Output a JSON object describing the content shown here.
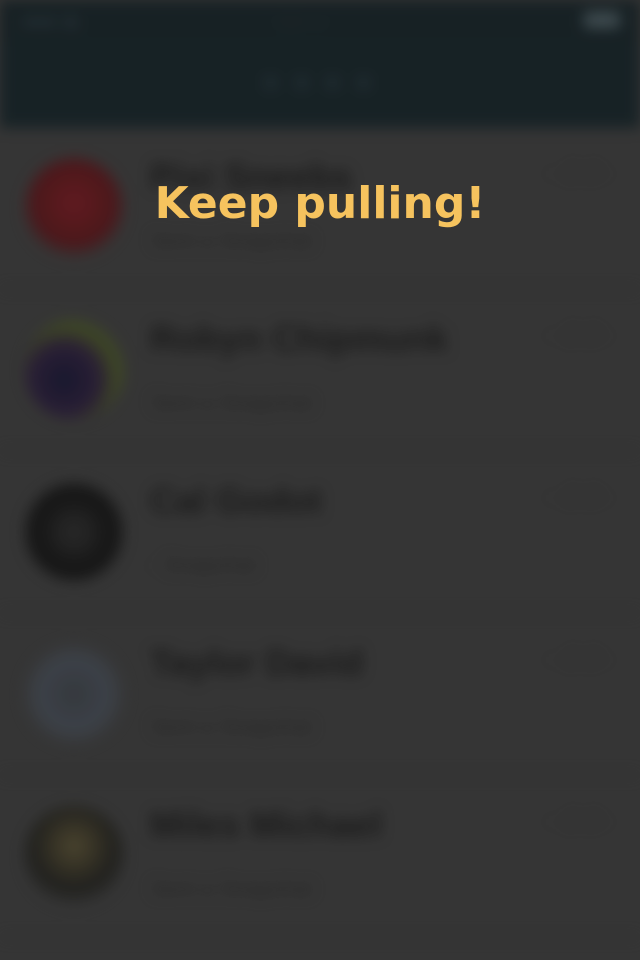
{
  "status_bar": {
    "carrier": "••••• ≋",
    "time": "··:·· ··"
  },
  "nav": {
    "title": "▪ ▪ ▪ ▪"
  },
  "overlay": {
    "message": "Keep pulling!"
  },
  "contacts": [
    {
      "name": "Pixi Sneebs",
      "subtitle": "Sent a Snapchat",
      "date": "· ·/··/··",
      "avatar_color": "#5a0f14"
    },
    {
      "name": "Robyn Chipmunk",
      "subtitle": "Sent a Snapchat",
      "date": "· ·/··/··",
      "avatar_color": "#1a1a3a"
    },
    {
      "name": "Cal Godot",
      "subtitle": "· Snapchat",
      "date": "· ·/··/··",
      "avatar_color": "#0c0c0c"
    },
    {
      "name": "Taylor David",
      "subtitle": "Sent a Snapchat",
      "date": "· ·/··/··",
      "avatar_color": "#3e4550"
    },
    {
      "name": "Miles Michael",
      "subtitle": "Sent a Snapchat",
      "date": "· ·/··/··",
      "avatar_color": "#1c1c18"
    }
  ]
}
